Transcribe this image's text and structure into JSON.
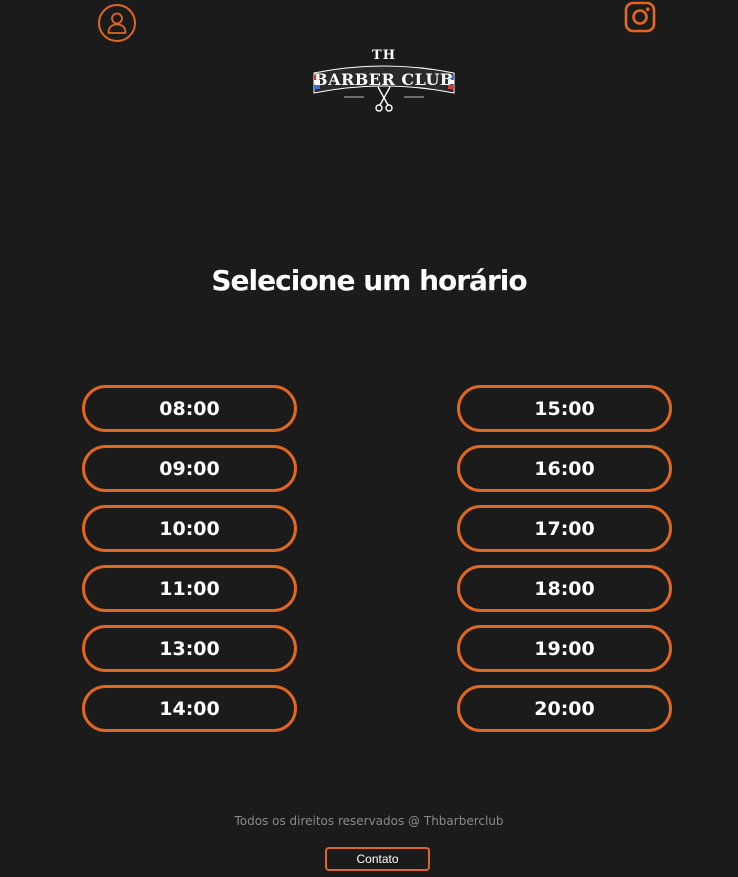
{
  "header": {
    "profile_icon": "user-icon",
    "instagram_icon": "instagram-icon",
    "logo_top": "TH",
    "logo_main": "BARBER CLUB",
    "accent_color": "#e06722"
  },
  "main": {
    "title": "Selecione um horário",
    "slots_left": [
      "08:00",
      "09:00",
      "10:00",
      "11:00",
      "13:00",
      "14:00"
    ],
    "slots_right": [
      "15:00",
      "16:00",
      "17:00",
      "18:00",
      "19:00",
      "20:00"
    ]
  },
  "footer": {
    "copyright": "Todos os direitos reservados @ Thbarberclub",
    "contact_label": "Contato"
  }
}
